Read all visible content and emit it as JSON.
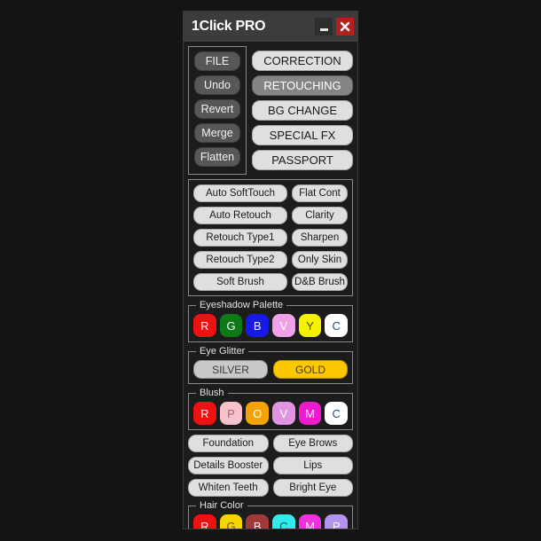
{
  "window": {
    "title": "1Click PRO",
    "minimize_label": "_",
    "close_label": "X"
  },
  "colors": {
    "panel_bg": "#1c1c1c",
    "titlebar_bg": "#3c3c3c",
    "button_light": "#dfdfdf",
    "button_dark": "#575757",
    "button_active": "#858585",
    "close_red": "#b4201f",
    "group_border": "#8a8a8a"
  },
  "file_ops": {
    "items": [
      {
        "label": "FILE"
      },
      {
        "label": "Undo"
      },
      {
        "label": "Revert"
      },
      {
        "label": "Merge"
      },
      {
        "label": "Flatten"
      }
    ]
  },
  "modes": {
    "items": [
      {
        "label": "CORRECTION",
        "active": false
      },
      {
        "label": "RETOUCHING",
        "active": true
      },
      {
        "label": "BG CHANGE",
        "active": false
      },
      {
        "label": "SPECIAL FX",
        "active": false
      },
      {
        "label": "PASSPORT",
        "active": false
      }
    ]
  },
  "retouch_tools": {
    "rows": [
      {
        "left": "Auto SoftTouch",
        "right": "Flat Cont"
      },
      {
        "left": "Auto Retouch",
        "right": "Clarity"
      },
      {
        "left": "Retouch Type1",
        "right": "Sharpen"
      },
      {
        "left": "Retouch Type2",
        "right": "Only Skin"
      },
      {
        "left": "Soft Brush",
        "right": "D&B Brush"
      }
    ]
  },
  "eyeshadow_palette": {
    "title": "Eyeshadow Palette",
    "swatches": [
      {
        "label": "R",
        "bg": "#ee1111",
        "fg": "#ffffff"
      },
      {
        "label": "G",
        "bg": "#0d7a17",
        "fg": "#ffffff"
      },
      {
        "label": "B",
        "bg": "#1919e6",
        "fg": "#ffffff"
      },
      {
        "label": "V",
        "bg": "#efa2e8",
        "fg": "#ffffff"
      },
      {
        "label": "Y",
        "bg": "#f5f200",
        "fg": "#4a4a00"
      },
      {
        "label": "C",
        "bg": "#ffffff",
        "fg": "#2b4a8a"
      }
    ]
  },
  "eye_glitter": {
    "title": "Eye Glitter",
    "silver_label": "SILVER",
    "gold_label": "GOLD"
  },
  "blush": {
    "title": "Blush",
    "swatches": [
      {
        "label": "R",
        "bg": "#ee1111",
        "fg": "#ffffff"
      },
      {
        "label": "P",
        "bg": "#f6c2cc",
        "fg": "#b06070"
      },
      {
        "label": "O",
        "bg": "#f5a300",
        "fg": "#ffffff"
      },
      {
        "label": "V",
        "bg": "#e294e2",
        "fg": "#ffffff"
      },
      {
        "label": "M",
        "bg": "#ee1bcd",
        "fg": "#ffffff"
      },
      {
        "label": "C",
        "bg": "#ffffff",
        "fg": "#2b4a8a"
      }
    ]
  },
  "makeup_tools": {
    "rows": [
      {
        "left": "Foundation",
        "right": "Eye Brows"
      },
      {
        "left": "Details Booster",
        "right": "Lips"
      },
      {
        "left": "Whiten Teeth",
        "right": "Bright Eye"
      }
    ]
  },
  "hair_color": {
    "title": "Hair Color",
    "swatches": [
      {
        "label": "R",
        "bg": "#ee1111",
        "fg": "#ffffff"
      },
      {
        "label": "G",
        "bg": "#f5d400",
        "fg": "#6a5a00"
      },
      {
        "label": "B",
        "bg": "#a03a3a",
        "fg": "#ffffff"
      },
      {
        "label": "C",
        "bg": "#33e9e9",
        "fg": "#135a6a"
      },
      {
        "label": "M",
        "bg": "#ee33dd",
        "fg": "#ffffff"
      },
      {
        "label": "P",
        "bg": "#b294ec",
        "fg": "#ffffff"
      }
    ]
  }
}
